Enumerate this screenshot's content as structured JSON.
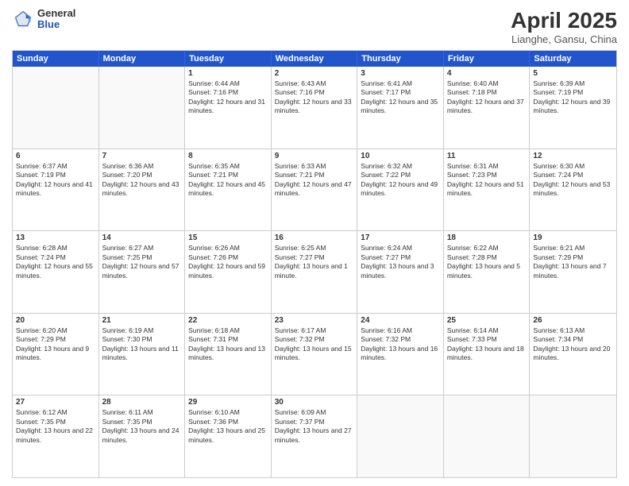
{
  "logo": {
    "general": "General",
    "blue": "Blue"
  },
  "title": {
    "month": "April 2025",
    "location": "Lianghe, Gansu, China"
  },
  "days_header": [
    "Sunday",
    "Monday",
    "Tuesday",
    "Wednesday",
    "Thursday",
    "Friday",
    "Saturday"
  ],
  "weeks": [
    [
      {
        "day": "",
        "sunrise": "",
        "sunset": "",
        "daylight": ""
      },
      {
        "day": "",
        "sunrise": "",
        "sunset": "",
        "daylight": ""
      },
      {
        "day": "1",
        "sunrise": "Sunrise: 6:44 AM",
        "sunset": "Sunset: 7:16 PM",
        "daylight": "Daylight: 12 hours and 31 minutes."
      },
      {
        "day": "2",
        "sunrise": "Sunrise: 6:43 AM",
        "sunset": "Sunset: 7:16 PM",
        "daylight": "Daylight: 12 hours and 33 minutes."
      },
      {
        "day": "3",
        "sunrise": "Sunrise: 6:41 AM",
        "sunset": "Sunset: 7:17 PM",
        "daylight": "Daylight: 12 hours and 35 minutes."
      },
      {
        "day": "4",
        "sunrise": "Sunrise: 6:40 AM",
        "sunset": "Sunset: 7:18 PM",
        "daylight": "Daylight: 12 hours and 37 minutes."
      },
      {
        "day": "5",
        "sunrise": "Sunrise: 6:39 AM",
        "sunset": "Sunset: 7:19 PM",
        "daylight": "Daylight: 12 hours and 39 minutes."
      }
    ],
    [
      {
        "day": "6",
        "sunrise": "Sunrise: 6:37 AM",
        "sunset": "Sunset: 7:19 PM",
        "daylight": "Daylight: 12 hours and 41 minutes."
      },
      {
        "day": "7",
        "sunrise": "Sunrise: 6:36 AM",
        "sunset": "Sunset: 7:20 PM",
        "daylight": "Daylight: 12 hours and 43 minutes."
      },
      {
        "day": "8",
        "sunrise": "Sunrise: 6:35 AM",
        "sunset": "Sunset: 7:21 PM",
        "daylight": "Daylight: 12 hours and 45 minutes."
      },
      {
        "day": "9",
        "sunrise": "Sunrise: 6:33 AM",
        "sunset": "Sunset: 7:21 PM",
        "daylight": "Daylight: 12 hours and 47 minutes."
      },
      {
        "day": "10",
        "sunrise": "Sunrise: 6:32 AM",
        "sunset": "Sunset: 7:22 PM",
        "daylight": "Daylight: 12 hours and 49 minutes."
      },
      {
        "day": "11",
        "sunrise": "Sunrise: 6:31 AM",
        "sunset": "Sunset: 7:23 PM",
        "daylight": "Daylight: 12 hours and 51 minutes."
      },
      {
        "day": "12",
        "sunrise": "Sunrise: 6:30 AM",
        "sunset": "Sunset: 7:24 PM",
        "daylight": "Daylight: 12 hours and 53 minutes."
      }
    ],
    [
      {
        "day": "13",
        "sunrise": "Sunrise: 6:28 AM",
        "sunset": "Sunset: 7:24 PM",
        "daylight": "Daylight: 12 hours and 55 minutes."
      },
      {
        "day": "14",
        "sunrise": "Sunrise: 6:27 AM",
        "sunset": "Sunset: 7:25 PM",
        "daylight": "Daylight: 12 hours and 57 minutes."
      },
      {
        "day": "15",
        "sunrise": "Sunrise: 6:26 AM",
        "sunset": "Sunset: 7:26 PM",
        "daylight": "Daylight: 12 hours and 59 minutes."
      },
      {
        "day": "16",
        "sunrise": "Sunrise: 6:25 AM",
        "sunset": "Sunset: 7:27 PM",
        "daylight": "Daylight: 13 hours and 1 minute."
      },
      {
        "day": "17",
        "sunrise": "Sunrise: 6:24 AM",
        "sunset": "Sunset: 7:27 PM",
        "daylight": "Daylight: 13 hours and 3 minutes."
      },
      {
        "day": "18",
        "sunrise": "Sunrise: 6:22 AM",
        "sunset": "Sunset: 7:28 PM",
        "daylight": "Daylight: 13 hours and 5 minutes."
      },
      {
        "day": "19",
        "sunrise": "Sunrise: 6:21 AM",
        "sunset": "Sunset: 7:29 PM",
        "daylight": "Daylight: 13 hours and 7 minutes."
      }
    ],
    [
      {
        "day": "20",
        "sunrise": "Sunrise: 6:20 AM",
        "sunset": "Sunset: 7:29 PM",
        "daylight": "Daylight: 13 hours and 9 minutes."
      },
      {
        "day": "21",
        "sunrise": "Sunrise: 6:19 AM",
        "sunset": "Sunset: 7:30 PM",
        "daylight": "Daylight: 13 hours and 11 minutes."
      },
      {
        "day": "22",
        "sunrise": "Sunrise: 6:18 AM",
        "sunset": "Sunset: 7:31 PM",
        "daylight": "Daylight: 13 hours and 13 minutes."
      },
      {
        "day": "23",
        "sunrise": "Sunrise: 6:17 AM",
        "sunset": "Sunset: 7:32 PM",
        "daylight": "Daylight: 13 hours and 15 minutes."
      },
      {
        "day": "24",
        "sunrise": "Sunrise: 6:16 AM",
        "sunset": "Sunset: 7:32 PM",
        "daylight": "Daylight: 13 hours and 16 minutes."
      },
      {
        "day": "25",
        "sunrise": "Sunrise: 6:14 AM",
        "sunset": "Sunset: 7:33 PM",
        "daylight": "Daylight: 13 hours and 18 minutes."
      },
      {
        "day": "26",
        "sunrise": "Sunrise: 6:13 AM",
        "sunset": "Sunset: 7:34 PM",
        "daylight": "Daylight: 13 hours and 20 minutes."
      }
    ],
    [
      {
        "day": "27",
        "sunrise": "Sunrise: 6:12 AM",
        "sunset": "Sunset: 7:35 PM",
        "daylight": "Daylight: 13 hours and 22 minutes."
      },
      {
        "day": "28",
        "sunrise": "Sunrise: 6:11 AM",
        "sunset": "Sunset: 7:35 PM",
        "daylight": "Daylight: 13 hours and 24 minutes."
      },
      {
        "day": "29",
        "sunrise": "Sunrise: 6:10 AM",
        "sunset": "Sunset: 7:36 PM",
        "daylight": "Daylight: 13 hours and 25 minutes."
      },
      {
        "day": "30",
        "sunrise": "Sunrise: 6:09 AM",
        "sunset": "Sunset: 7:37 PM",
        "daylight": "Daylight: 13 hours and 27 minutes."
      },
      {
        "day": "",
        "sunrise": "",
        "sunset": "",
        "daylight": ""
      },
      {
        "day": "",
        "sunrise": "",
        "sunset": "",
        "daylight": ""
      },
      {
        "day": "",
        "sunrise": "",
        "sunset": "",
        "daylight": ""
      }
    ]
  ]
}
